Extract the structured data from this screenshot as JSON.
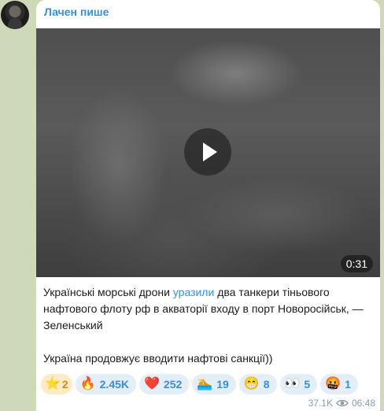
{
  "post": {
    "author": "Лачен пише",
    "video": {
      "duration": "0:31"
    },
    "text": {
      "p1_before": "Українські морські дрони ",
      "p1_link": "уразили",
      "p1_after": " два танкери тіньового нафтового флоту рф в акваторії входу в порт Новоросійськ, — Зеленський",
      "p2": "Україна продовжує вводити нафтові санкції))"
    },
    "reactions": [
      {
        "icon": "star-icon",
        "emoji": "⭐",
        "count": "2"
      },
      {
        "icon": "fire-icon",
        "emoji": "🔥",
        "count": "2.45K"
      },
      {
        "icon": "heart-icon",
        "emoji": "❤️",
        "count": "252"
      },
      {
        "icon": "swimmer-icon",
        "emoji": "🏊",
        "count": "19"
      },
      {
        "icon": "grin-icon",
        "emoji": "😁",
        "count": "8"
      },
      {
        "icon": "eyes-icon",
        "emoji": "👀",
        "count": "5"
      },
      {
        "icon": "angry-face-icon",
        "emoji": "🤬",
        "count": "1"
      }
    ],
    "views": "37.1K",
    "time": "06:48"
  },
  "colors": {
    "accent": "#3a8fd0",
    "background": "#cfd8b8"
  }
}
